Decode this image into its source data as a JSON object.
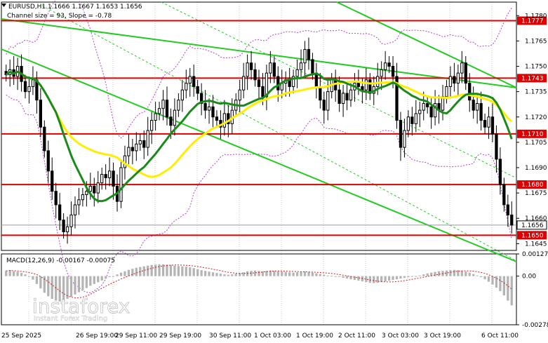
{
  "header": {
    "title_line": "EURUSD,H1  1.1666 1.1667 1.1653 1.1656",
    "channel_line": "Channel size = 93, Slope = -0.78"
  },
  "macd": {
    "label": "MACD(12,26,9) -0.00167 -0.00075",
    "ticks": [
      "0.00127",
      "0.00",
      "-0.00278"
    ]
  },
  "watermark": {
    "brand": "instaforex",
    "tagline": "Instant Forex Trading"
  },
  "colors": {
    "background": "#ffffff",
    "grid": "#c8c8c8",
    "candle": "#000000",
    "ma_yellow": "#ffee00",
    "ma_green": "#1a8a1a",
    "channel": "#22cc22",
    "level_line": "#dd0000",
    "level_tag_bg": "#dd0000",
    "bollinger": "#b040d0",
    "macd_hist": "#b4b4b4"
  },
  "chart_data": {
    "type": "candlestick",
    "symbol": "EURUSD",
    "timeframe": "H1",
    "ylim": [
      1.1641,
      1.1788
    ],
    "y_ticks": [
      "1.1780",
      "1.1765",
      "1.1750",
      "1.1735",
      "1.1720",
      "1.1705",
      "1.1690",
      "1.1675",
      "1.1660",
      "1.1645"
    ],
    "x_ticks": [
      "25 Sep 2025",
      "26 Sep 19:00",
      "29 Sep 11:00",
      "29 Sep 19:00",
      "30 Sep 11:00",
      "1 Oct 03:00",
      "1 Oct 19:00",
      "2 Oct 11:00",
      "3 Oct 03:00",
      "3 Oct 19:00",
      "6 Oct 11:00"
    ],
    "levels": [
      {
        "label": "1.1777",
        "value": 1.1777
      },
      {
        "label": "1.1743",
        "value": 1.1743
      },
      {
        "label": "1.1710",
        "value": 1.171
      },
      {
        "label": "1.1680",
        "value": 1.168
      },
      {
        "label": "1.1650",
        "value": 1.165
      }
    ],
    "current_price": {
      "label": "1.1656",
      "value": 1.1656
    },
    "ohlc": {
      "open": 1.1666,
      "high": 1.1667,
      "low": 1.1653,
      "close": 1.1656
    },
    "channel": {
      "size": 93,
      "slope": -0.78
    },
    "closes": [
      1.1745,
      1.1748,
      1.1744,
      1.175,
      1.1741,
      1.1735,
      1.1738,
      1.1742,
      1.173,
      1.1714,
      1.17,
      1.1688,
      1.1676,
      1.1668,
      1.1659,
      1.1652,
      1.1655,
      1.1662,
      1.1668,
      1.1671,
      1.1674,
      1.1676,
      1.1679,
      1.1675,
      1.1681,
      1.1686,
      1.1684,
      1.1688,
      1.1679,
      1.167,
      1.169,
      1.1697,
      1.1702,
      1.17,
      1.1704,
      1.1706,
      1.1702,
      1.1712,
      1.1718,
      1.1722,
      1.1725,
      1.173,
      1.172,
      1.1715,
      1.1724,
      1.173,
      1.1736,
      1.174,
      1.1744,
      1.1738,
      1.1734,
      1.1728,
      1.1724,
      1.1726,
      1.172,
      1.1718,
      1.1714,
      1.1722,
      1.1716,
      1.1724,
      1.173,
      1.1736,
      1.1744,
      1.1752,
      1.1748,
      1.1742,
      1.1738,
      1.1732,
      1.1746,
      1.1752,
      1.1744,
      1.1736,
      1.174,
      1.1742,
      1.1738,
      1.1744,
      1.1748,
      1.1752,
      1.176,
      1.1754,
      1.1746,
      1.1738,
      1.173,
      1.1724,
      1.1735,
      1.1742,
      1.1736,
      1.1728,
      1.1734,
      1.173,
      1.1736,
      1.174,
      1.1738,
      1.1736,
      1.1742,
      1.1734,
      1.1738,
      1.1744,
      1.1748,
      1.1752,
      1.175,
      1.1744,
      1.1718,
      1.1702,
      1.1712,
      1.172,
      1.1716,
      1.1722,
      1.1724,
      1.1728,
      1.1726,
      1.172,
      1.1728,
      1.1724,
      1.1732,
      1.1738,
      1.1744,
      1.174,
      1.1746,
      1.1752,
      1.174,
      1.173,
      1.1724,
      1.1728,
      1.1718,
      1.1714,
      1.172,
      1.171,
      1.1695,
      1.168,
      1.1668,
      1.1662,
      1.1656
    ],
    "macd_hist": [
      0.0003,
      0.00035,
      0.00028,
      0.00025,
      0.00018,
      0.0001,
      0.0,
      -0.0002,
      -0.00045,
      -0.0007,
      -0.00095,
      -0.00115,
      -0.0013,
      -0.0014,
      -0.00145,
      -0.0014,
      -0.0013,
      -0.00118,
      -0.00105,
      -0.00092,
      -0.0008,
      -0.00068,
      -0.00055,
      -0.00045,
      -0.00035,
      -0.00025,
      -0.00015,
      -5e-05,
      0.0,
      0.0001,
      0.0002,
      0.00028,
      0.00036,
      0.00042,
      0.00048,
      0.00052,
      0.00056,
      0.0006,
      0.00064,
      0.00066,
      0.00068,
      0.00068,
      0.00066,
      0.00064,
      0.0006,
      0.00058,
      0.00056,
      0.00054,
      0.0005,
      0.00046,
      0.0004,
      0.00034,
      0.0003,
      0.00026,
      0.00022,
      0.00018,
      0.00014,
      0.0001,
      8e-05,
      0.0001,
      0.00014,
      0.00018,
      0.00022,
      0.00028,
      0.0003,
      0.00032,
      0.0003,
      0.00028,
      0.0003,
      0.00032,
      0.0003,
      0.00028,
      0.00026,
      0.00024,
      0.00022,
      0.0002,
      0.00022,
      0.00024,
      0.00026,
      0.00024,
      0.0002,
      0.00016,
      0.00012,
      8e-05,
      4e-05,
      2e-05,
      0.0,
      -4e-05,
      -0.0001,
      -0.00014,
      -0.00018,
      -0.00022,
      -0.00026,
      -0.0003,
      -0.00034,
      -0.00038,
      -0.0004,
      -0.00038,
      -0.00034,
      -0.0003,
      -0.00026,
      -0.00022,
      -0.00018,
      -0.00014,
      -0.0001,
      -6e-05,
      -2e-05,
      0.0,
      4e-05,
      0.0001,
      0.00016,
      0.0002,
      0.00024,
      0.00028,
      0.0003,
      0.00032,
      0.00034,
      0.00036,
      0.00034,
      0.0003,
      0.00026,
      0.0002,
      0.00012,
      4e-05,
      -6e-05,
      -0.00018,
      -0.00032,
      -0.00048,
      -0.00066,
      -0.00086,
      -0.0011,
      -0.0014,
      -0.00167
    ]
  }
}
